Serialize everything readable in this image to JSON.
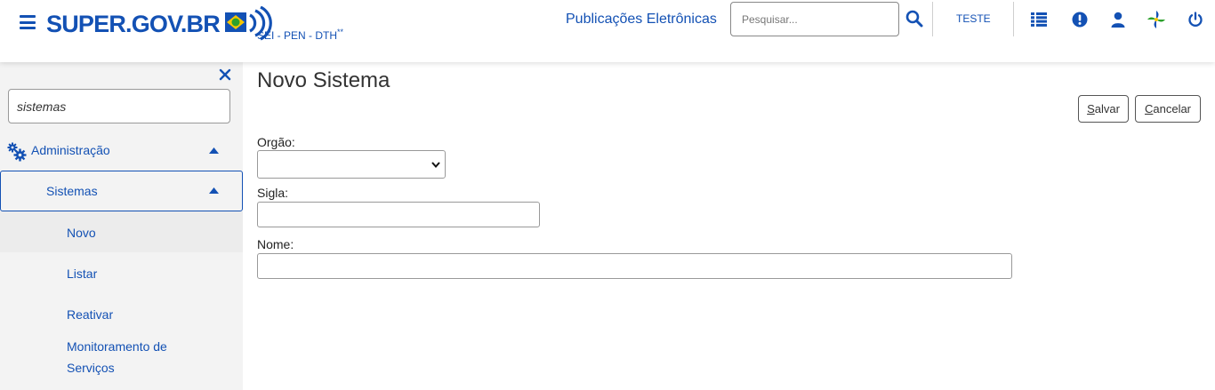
{
  "header": {
    "logo_text": "SUPER.GOV.BR",
    "subtitle": "SEI - PEN - DTH",
    "subtitle_sup": "**",
    "pub_title": "Publicações Eletrônicas",
    "search_placeholder": "Pesquisar...",
    "user_label": "TESTE",
    "icons": [
      "menu-icon",
      "search-icon",
      "grid-list-icon",
      "alert-icon",
      "user-icon",
      "pinwheel-icon",
      "power-icon"
    ]
  },
  "sidebar": {
    "search_value": "sistemas",
    "admin_label": "Administração",
    "sistemas_label": "Sistemas",
    "items": [
      {
        "label": "Novo"
      },
      {
        "label": "Listar"
      },
      {
        "label": "Reativar"
      },
      {
        "label": "Monitoramento de"
      },
      {
        "label": "Serviços"
      }
    ]
  },
  "main": {
    "title": "Novo Sistema",
    "save_prefix": "S",
    "save_rest": "alvar",
    "cancel_prefix": "C",
    "cancel_rest": "ancelar",
    "orgao_label": "Orgão:",
    "sigla_label": "Sigla:",
    "nome_label": "Nome:"
  },
  "colors": {
    "primary": "#1351b4",
    "sidebar_bg": "#f3f3f3"
  }
}
